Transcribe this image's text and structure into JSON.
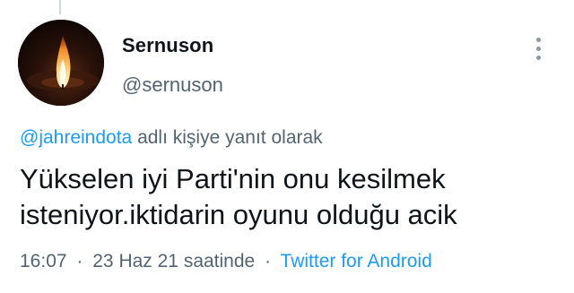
{
  "tweet": {
    "author": {
      "display_name": "Sernuson",
      "handle": "@sernuson"
    },
    "reply_to": {
      "mention": "@jahreindota",
      "suffix": "adlı kişiye yanıt olarak"
    },
    "text_line1": "Yükselen iyi Parti'nin onu kesilmek",
    "text_line2": "isteniyor.iktidarin oyunu olduğu acik",
    "time": "16:07",
    "separator": "·",
    "date": "23 Haz 21 saatinde",
    "source": "Twitter for Android"
  },
  "icons": {
    "avatar": "candle-flame-avatar",
    "more": "more-vertical-icon"
  },
  "colors": {
    "link": "#1d9bf0",
    "secondary_text": "#536471",
    "primary_text": "#0f1419",
    "thread_line": "#cfd9de"
  }
}
